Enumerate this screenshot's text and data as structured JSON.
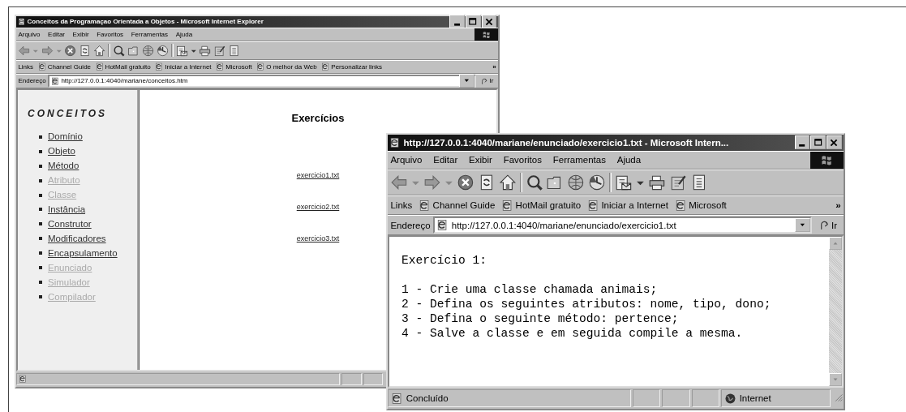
{
  "windows": [
    {
      "title": "Conceitos da Programaçao Orientada a Objetos - Microsoft Internet Explorer",
      "menu": [
        "Arquivo",
        "Editar",
        "Exibir",
        "Favoritos",
        "Ferramentas",
        "Ajuda"
      ],
      "links_label": "Links",
      "links": [
        "Channel Guide",
        "HotMail gratuito",
        "Iniciar a Internet",
        "Microsoft",
        "O melhor da Web",
        "Personalizar links"
      ],
      "links_more": "»",
      "address_label": "Endereço",
      "address": "http://127.0.0.1:4040/mariane/conceitos.htm",
      "go": "Ir",
      "content": {
        "kind": "frameset",
        "sidebar": {
          "title": "CONCEITOS",
          "items": [
            {
              "label": "Domínio",
              "visited": false
            },
            {
              "label": "Objeto",
              "visited": false
            },
            {
              "label": "Método",
              "visited": false
            },
            {
              "label": "Atributo",
              "visited": true
            },
            {
              "label": "Classe",
              "visited": true
            },
            {
              "label": "Instância",
              "visited": false
            },
            {
              "label": "Construtor",
              "visited": false
            },
            {
              "label": "Modificadores",
              "visited": false
            },
            {
              "label": "Encapsulamento",
              "visited": false
            },
            {
              "label": "Enunciado",
              "visited": true
            },
            {
              "label": "Simulador",
              "visited": true
            },
            {
              "label": "Compilador",
              "visited": true
            }
          ]
        },
        "main": {
          "heading": "Exercícios",
          "links": [
            "exercicio1.txt",
            "exercicio2.txt",
            "exercicio3.txt"
          ]
        }
      }
    },
    {
      "title": "http://127.0.0.1:4040/mariane/enunciado/exercicio1.txt - Microsoft Intern...",
      "menu": [
        "Arquivo",
        "Editar",
        "Exibir",
        "Favoritos",
        "Ferramentas",
        "Ajuda"
      ],
      "links_label": "Links",
      "links": [
        "Channel Guide",
        "HotMail gratuito",
        "Iniciar a Internet",
        "Microsoft"
      ],
      "links_more": "»",
      "address_label": "Endereço",
      "address": "http://127.0.0.1:4040/mariane/enunciado/exercicio1.txt",
      "go": "Ir",
      "content": {
        "kind": "text",
        "heading": "Exercício 1:",
        "lines": [
          "1 - Crie uma classe chamada animais;",
          "2 - Defina os seguintes atributos: nome, tipo, dono;",
          "3 - Defina o seguinte método: pertence;",
          "4 - Salve a classe e em seguida compile a mesma."
        ]
      },
      "status": {
        "text": "Concluído",
        "zone": "Internet"
      }
    }
  ]
}
